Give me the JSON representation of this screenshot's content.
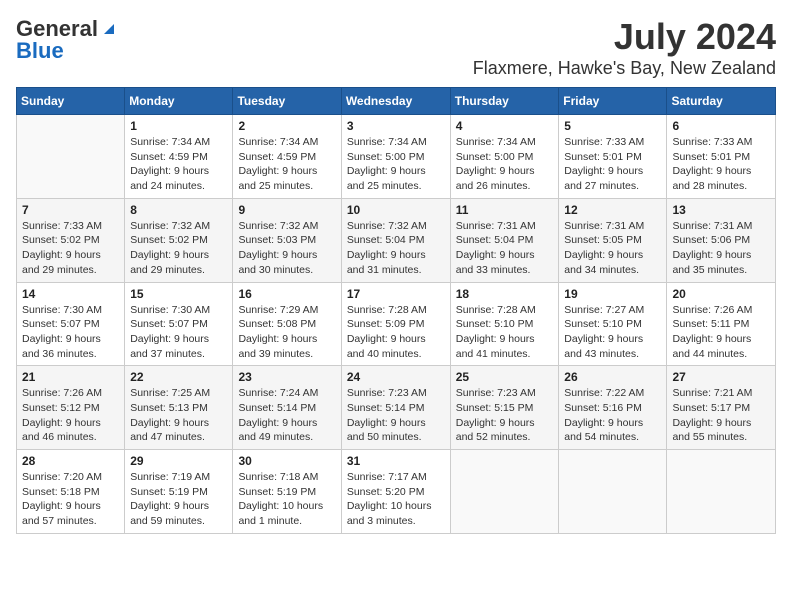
{
  "logo": {
    "general": "General",
    "blue": "Blue"
  },
  "title": "July 2024",
  "subtitle": "Flaxmere, Hawke's Bay, New Zealand",
  "days_of_week": [
    "Sunday",
    "Monday",
    "Tuesday",
    "Wednesday",
    "Thursday",
    "Friday",
    "Saturday"
  ],
  "weeks": [
    [
      {
        "num": "",
        "info": ""
      },
      {
        "num": "1",
        "info": "Sunrise: 7:34 AM\nSunset: 4:59 PM\nDaylight: 9 hours\nand 24 minutes."
      },
      {
        "num": "2",
        "info": "Sunrise: 7:34 AM\nSunset: 4:59 PM\nDaylight: 9 hours\nand 25 minutes."
      },
      {
        "num": "3",
        "info": "Sunrise: 7:34 AM\nSunset: 5:00 PM\nDaylight: 9 hours\nand 25 minutes."
      },
      {
        "num": "4",
        "info": "Sunrise: 7:34 AM\nSunset: 5:00 PM\nDaylight: 9 hours\nand 26 minutes."
      },
      {
        "num": "5",
        "info": "Sunrise: 7:33 AM\nSunset: 5:01 PM\nDaylight: 9 hours\nand 27 minutes."
      },
      {
        "num": "6",
        "info": "Sunrise: 7:33 AM\nSunset: 5:01 PM\nDaylight: 9 hours\nand 28 minutes."
      }
    ],
    [
      {
        "num": "7",
        "info": "Sunrise: 7:33 AM\nSunset: 5:02 PM\nDaylight: 9 hours\nand 29 minutes."
      },
      {
        "num": "8",
        "info": "Sunrise: 7:32 AM\nSunset: 5:02 PM\nDaylight: 9 hours\nand 29 minutes."
      },
      {
        "num": "9",
        "info": "Sunrise: 7:32 AM\nSunset: 5:03 PM\nDaylight: 9 hours\nand 30 minutes."
      },
      {
        "num": "10",
        "info": "Sunrise: 7:32 AM\nSunset: 5:04 PM\nDaylight: 9 hours\nand 31 minutes."
      },
      {
        "num": "11",
        "info": "Sunrise: 7:31 AM\nSunset: 5:04 PM\nDaylight: 9 hours\nand 33 minutes."
      },
      {
        "num": "12",
        "info": "Sunrise: 7:31 AM\nSunset: 5:05 PM\nDaylight: 9 hours\nand 34 minutes."
      },
      {
        "num": "13",
        "info": "Sunrise: 7:31 AM\nSunset: 5:06 PM\nDaylight: 9 hours\nand 35 minutes."
      }
    ],
    [
      {
        "num": "14",
        "info": "Sunrise: 7:30 AM\nSunset: 5:07 PM\nDaylight: 9 hours\nand 36 minutes."
      },
      {
        "num": "15",
        "info": "Sunrise: 7:30 AM\nSunset: 5:07 PM\nDaylight: 9 hours\nand 37 minutes."
      },
      {
        "num": "16",
        "info": "Sunrise: 7:29 AM\nSunset: 5:08 PM\nDaylight: 9 hours\nand 39 minutes."
      },
      {
        "num": "17",
        "info": "Sunrise: 7:28 AM\nSunset: 5:09 PM\nDaylight: 9 hours\nand 40 minutes."
      },
      {
        "num": "18",
        "info": "Sunrise: 7:28 AM\nSunset: 5:10 PM\nDaylight: 9 hours\nand 41 minutes."
      },
      {
        "num": "19",
        "info": "Sunrise: 7:27 AM\nSunset: 5:10 PM\nDaylight: 9 hours\nand 43 minutes."
      },
      {
        "num": "20",
        "info": "Sunrise: 7:26 AM\nSunset: 5:11 PM\nDaylight: 9 hours\nand 44 minutes."
      }
    ],
    [
      {
        "num": "21",
        "info": "Sunrise: 7:26 AM\nSunset: 5:12 PM\nDaylight: 9 hours\nand 46 minutes."
      },
      {
        "num": "22",
        "info": "Sunrise: 7:25 AM\nSunset: 5:13 PM\nDaylight: 9 hours\nand 47 minutes."
      },
      {
        "num": "23",
        "info": "Sunrise: 7:24 AM\nSunset: 5:14 PM\nDaylight: 9 hours\nand 49 minutes."
      },
      {
        "num": "24",
        "info": "Sunrise: 7:23 AM\nSunset: 5:14 PM\nDaylight: 9 hours\nand 50 minutes."
      },
      {
        "num": "25",
        "info": "Sunrise: 7:23 AM\nSunset: 5:15 PM\nDaylight: 9 hours\nand 52 minutes."
      },
      {
        "num": "26",
        "info": "Sunrise: 7:22 AM\nSunset: 5:16 PM\nDaylight: 9 hours\nand 54 minutes."
      },
      {
        "num": "27",
        "info": "Sunrise: 7:21 AM\nSunset: 5:17 PM\nDaylight: 9 hours\nand 55 minutes."
      }
    ],
    [
      {
        "num": "28",
        "info": "Sunrise: 7:20 AM\nSunset: 5:18 PM\nDaylight: 9 hours\nand 57 minutes."
      },
      {
        "num": "29",
        "info": "Sunrise: 7:19 AM\nSunset: 5:19 PM\nDaylight: 9 hours\nand 59 minutes."
      },
      {
        "num": "30",
        "info": "Sunrise: 7:18 AM\nSunset: 5:19 PM\nDaylight: 10 hours\nand 1 minute."
      },
      {
        "num": "31",
        "info": "Sunrise: 7:17 AM\nSunset: 5:20 PM\nDaylight: 10 hours\nand 3 minutes."
      },
      {
        "num": "",
        "info": ""
      },
      {
        "num": "",
        "info": ""
      },
      {
        "num": "",
        "info": ""
      }
    ]
  ]
}
